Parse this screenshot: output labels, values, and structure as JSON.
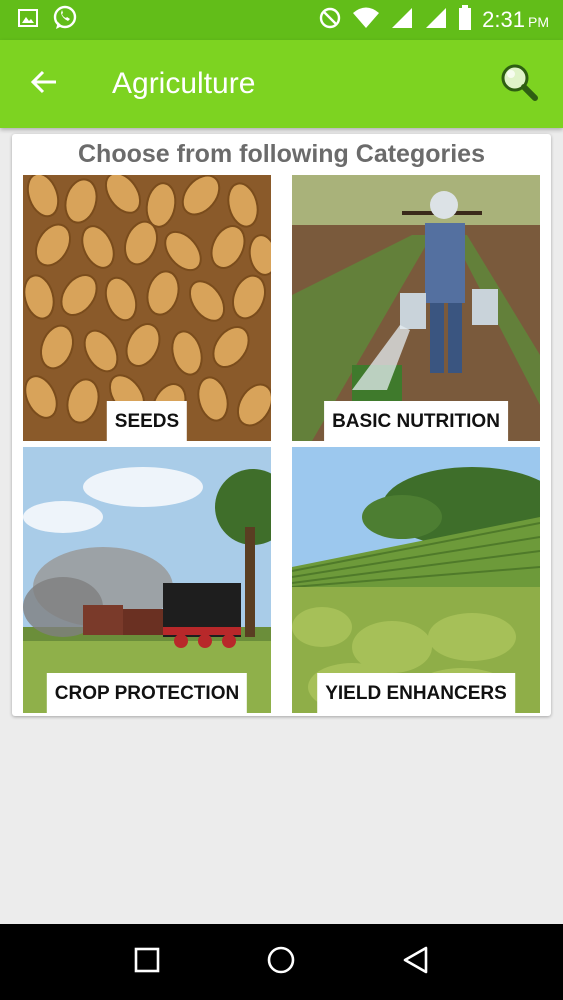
{
  "status_bar": {
    "time": "2:31",
    "ampm": "PM",
    "icons": [
      "image-icon",
      "whatsapp-icon",
      "do-not-disturb-icon",
      "wifi-icon",
      "signal-icon",
      "signal-icon",
      "battery-icon"
    ]
  },
  "app_bar": {
    "title": "Agriculture",
    "back_icon": "arrow-left-icon",
    "search_icon": "search-icon"
  },
  "categories": {
    "heading": "Choose from following Categories",
    "items": [
      {
        "label": "SEEDS"
      },
      {
        "label": "BASIC NUTRITION"
      },
      {
        "label": "CROP PROTECTION"
      },
      {
        "label": "YIELD ENHANCERS"
      }
    ]
  },
  "nav_bar": {
    "icons": [
      "recent-apps-icon",
      "home-icon",
      "back-triangle-icon"
    ]
  },
  "colors": {
    "status_bar": "#62bd19",
    "app_bar": "#7dd321",
    "background": "#ececec",
    "heading_text": "#6b6b6b"
  }
}
